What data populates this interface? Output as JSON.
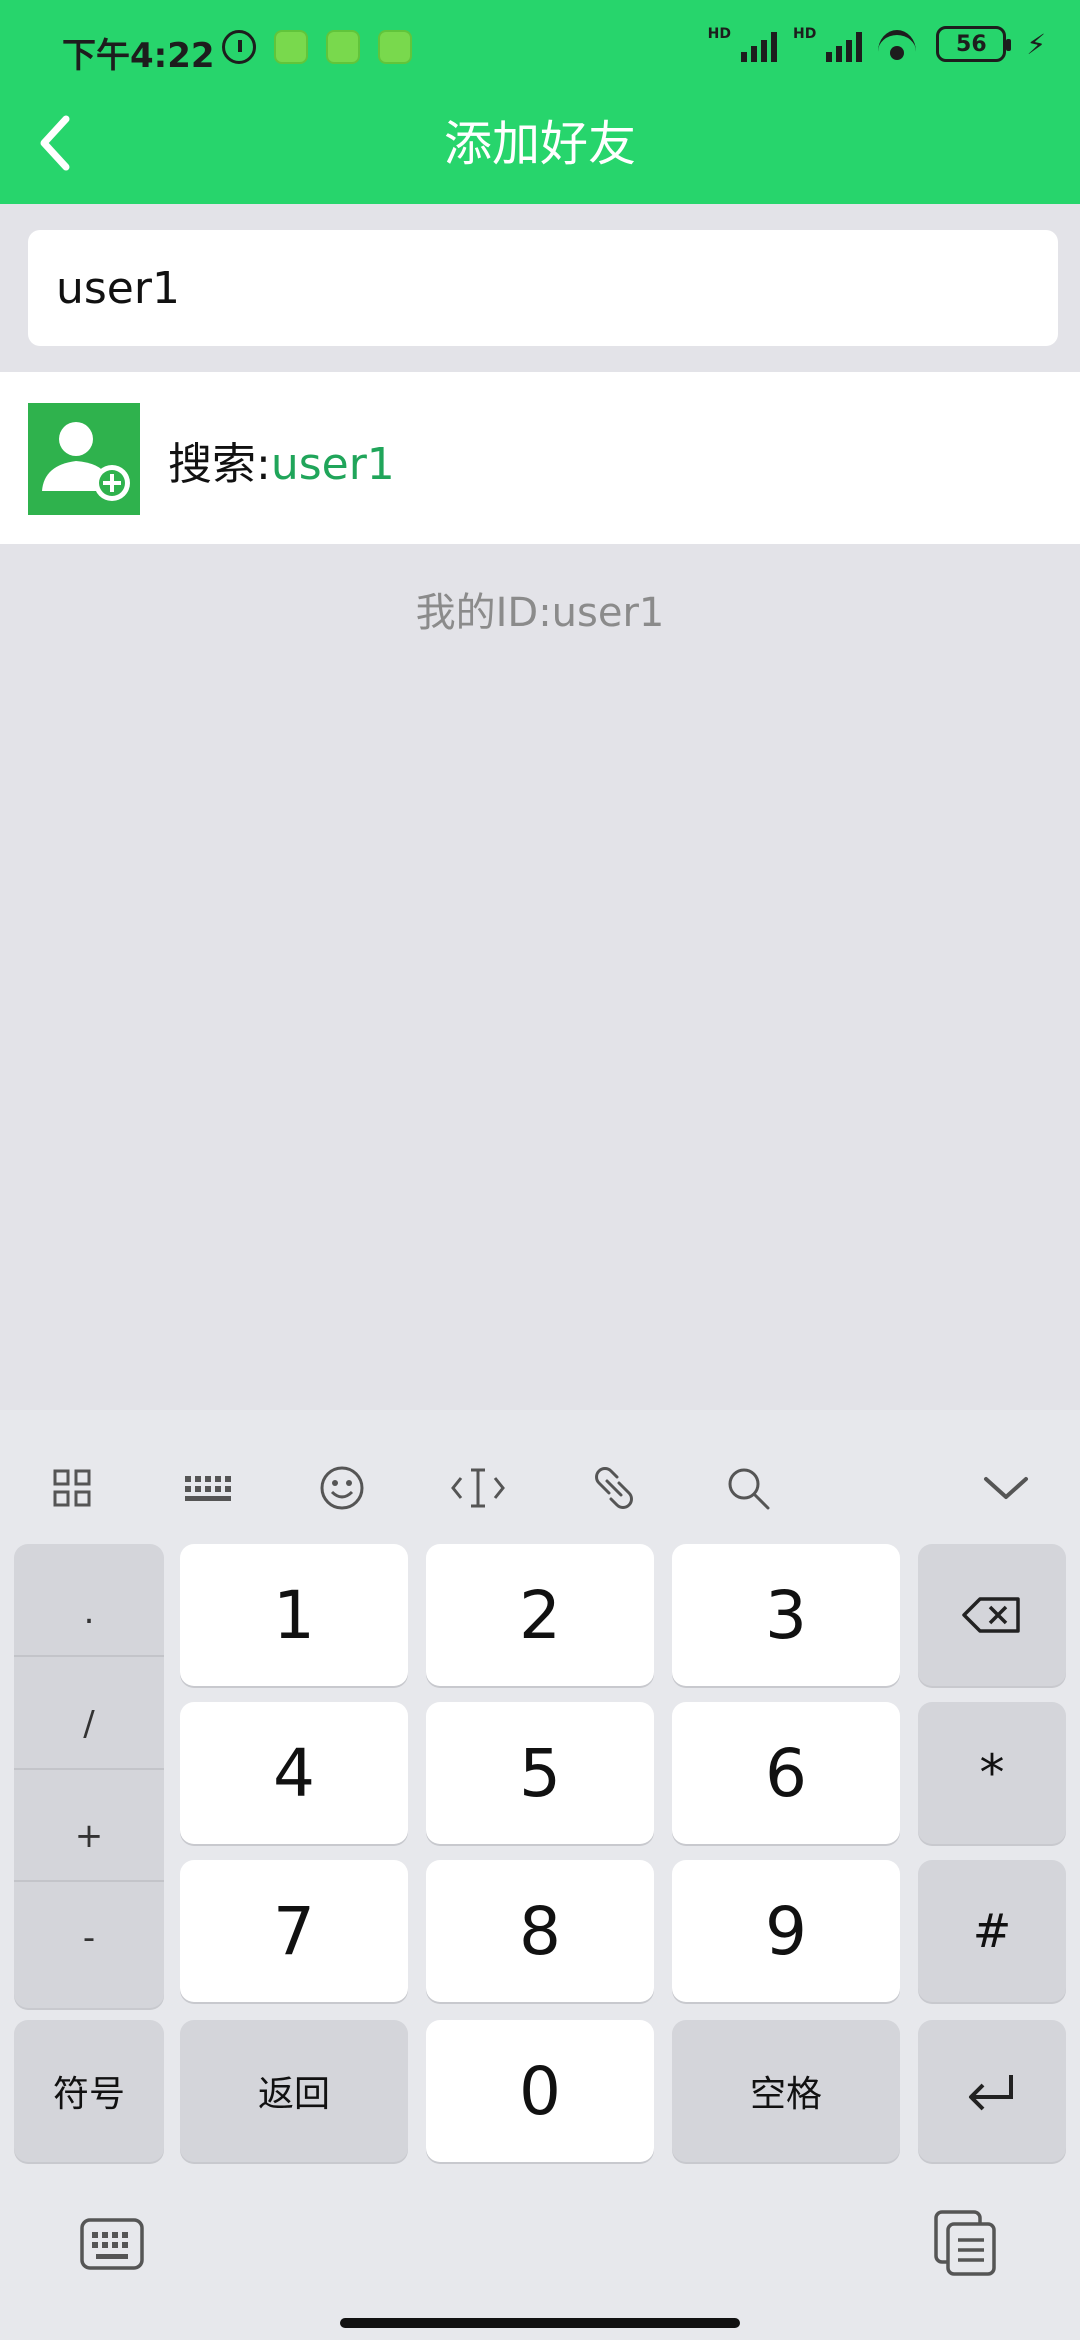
{
  "status_bar": {
    "time": "下午4:22",
    "battery": "56",
    "network_1": "HD",
    "network_2": "HD"
  },
  "header": {
    "title": "添加好友",
    "back_icon": "chevron-left-icon"
  },
  "search": {
    "value": "user1",
    "placeholder": ""
  },
  "result": {
    "label": "搜索:",
    "query": "user1",
    "icon": "add-user-icon"
  },
  "my_id": "我的ID:user1",
  "keyboard": {
    "toolbar_icons": [
      "grid-icon",
      "keyboard-icon",
      "emoji-icon",
      "cursor-icon",
      "link-icon",
      "search-icon",
      "chevron-down-icon"
    ],
    "side_keys": [
      ".",
      "/",
      "+",
      "-"
    ],
    "digits": [
      "1",
      "2",
      "3",
      "4",
      "5",
      "6",
      "7",
      "8",
      "9",
      "0"
    ],
    "star": "*",
    "hash": "#",
    "symbols": "符号",
    "back": "返回",
    "space": "空格"
  }
}
